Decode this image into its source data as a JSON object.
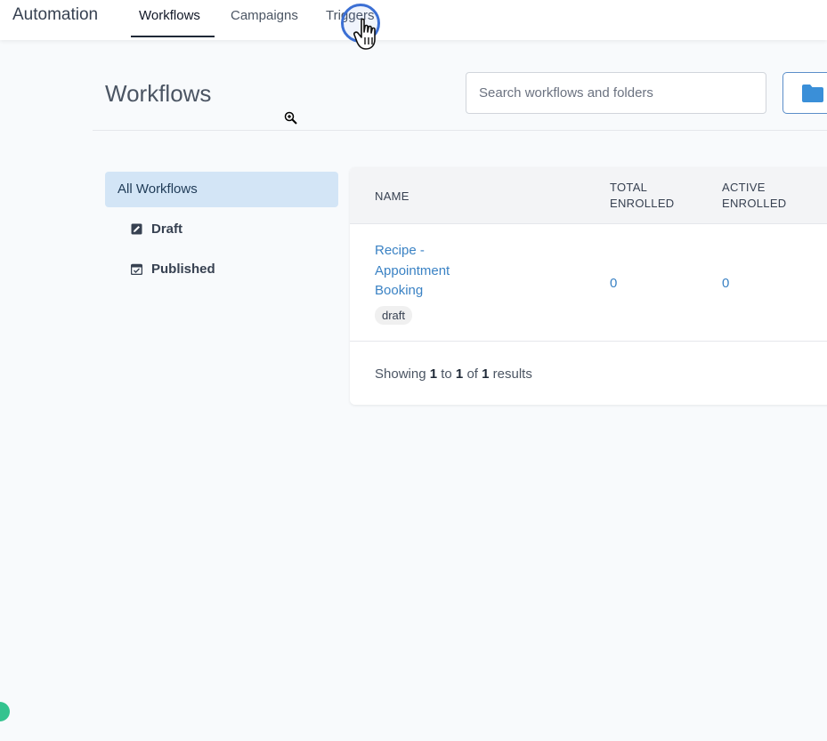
{
  "app": {
    "title": "Automation"
  },
  "nav": {
    "tabs": [
      {
        "label": "Workflows",
        "active": true
      },
      {
        "label": "Campaigns",
        "active": false
      },
      {
        "label": "Triggers",
        "active": false
      }
    ]
  },
  "header": {
    "title": "Workflows",
    "search_placeholder": "Search workflows and folders",
    "folder_icon": "folder-icon"
  },
  "sidebar": {
    "items": [
      {
        "label": "All Workflows",
        "active": true
      },
      {
        "label": "Draft",
        "icon": "draft-icon"
      },
      {
        "label": "Published",
        "icon": "calendar-check-icon"
      }
    ]
  },
  "table": {
    "columns": [
      {
        "line1": "NAME",
        "line2": ""
      },
      {
        "line1": "TOTAL",
        "line2": "ENROLLED"
      },
      {
        "line1": "ACTIVE",
        "line2": "ENROLLED"
      }
    ],
    "rows": [
      {
        "name_lines": [
          "Recipe -",
          "Appointment",
          "Booking"
        ],
        "badge": "draft",
        "total_enrolled": "0",
        "active_enrolled": "0"
      }
    ],
    "footer": {
      "prefix": "Showing",
      "from": "1",
      "to_word": "to",
      "to": "1",
      "of_word": "of",
      "total": "1",
      "suffix": "results"
    }
  },
  "colors": {
    "accent": "#3a82c4",
    "active_bg": "#d3e5f6",
    "cursor_ring": "#3b6fd4",
    "status_dot": "#34c38f"
  }
}
